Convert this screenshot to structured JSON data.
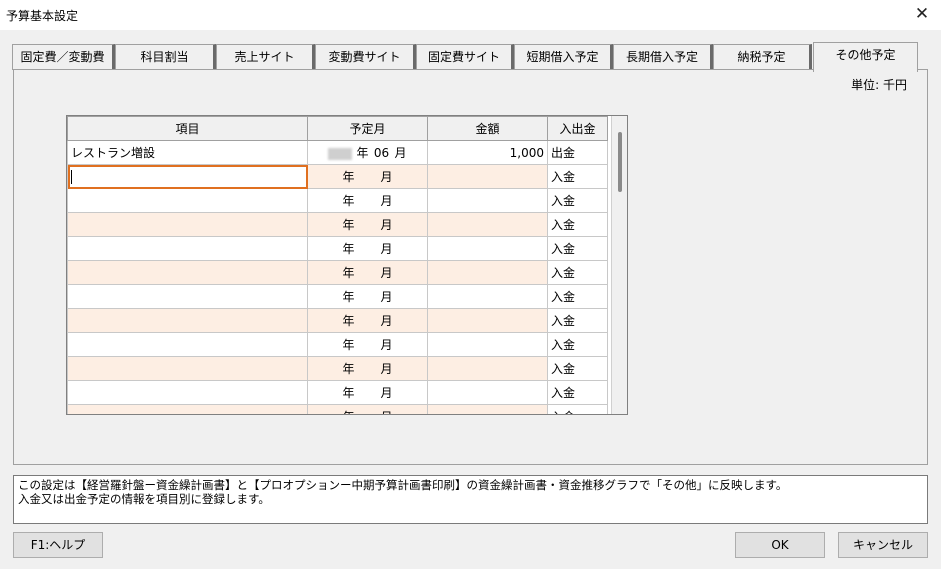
{
  "window": {
    "title": "予算基本設定",
    "close_glyph": "✕"
  },
  "tabs": [
    {
      "label": "固定費／変動費"
    },
    {
      "label": "科目割当"
    },
    {
      "label": "売上サイト"
    },
    {
      "label": "変動費サイト"
    },
    {
      "label": "固定費サイト"
    },
    {
      "label": "短期借入予定"
    },
    {
      "label": "長期借入予定"
    },
    {
      "label": "納税予定"
    },
    {
      "label": "その他予定"
    }
  ],
  "active_tab": "その他予定",
  "unit_label": "単位: 千円",
  "table": {
    "headers": [
      "項目",
      "予定月",
      "金額",
      "入出金"
    ],
    "year_suffix": "年",
    "month_suffix": "月",
    "rows": [
      {
        "item": "レストラン増設",
        "month": "06",
        "amount": "1,000",
        "io": "出金"
      },
      {
        "item": "",
        "month": "",
        "amount": "",
        "io": "入金"
      },
      {
        "item": "",
        "month": "",
        "amount": "",
        "io": "入金"
      },
      {
        "item": "",
        "month": "",
        "amount": "",
        "io": "入金"
      },
      {
        "item": "",
        "month": "",
        "amount": "",
        "io": "入金"
      },
      {
        "item": "",
        "month": "",
        "amount": "",
        "io": "入金"
      },
      {
        "item": "",
        "month": "",
        "amount": "",
        "io": "入金"
      },
      {
        "item": "",
        "month": "",
        "amount": "",
        "io": "入金"
      },
      {
        "item": "",
        "month": "",
        "amount": "",
        "io": "入金"
      },
      {
        "item": "",
        "month": "",
        "amount": "",
        "io": "入金"
      },
      {
        "item": "",
        "month": "",
        "amount": "",
        "io": "入金"
      },
      {
        "item": "",
        "month": "",
        "amount": "",
        "io": "入金"
      }
    ]
  },
  "description": {
    "line1": "この設定は【経営羅針盤ー資金繰計画書】と【プロオプションー中期予算計画書印刷】の資金繰計画書・資金推移グラフで「その他」に反映します。",
    "line2": "入金又は出金予定の情報を項目別に登録します。"
  },
  "buttons": {
    "help": "F1:ヘルプ",
    "ok": "OK",
    "cancel": "キャンセル"
  }
}
